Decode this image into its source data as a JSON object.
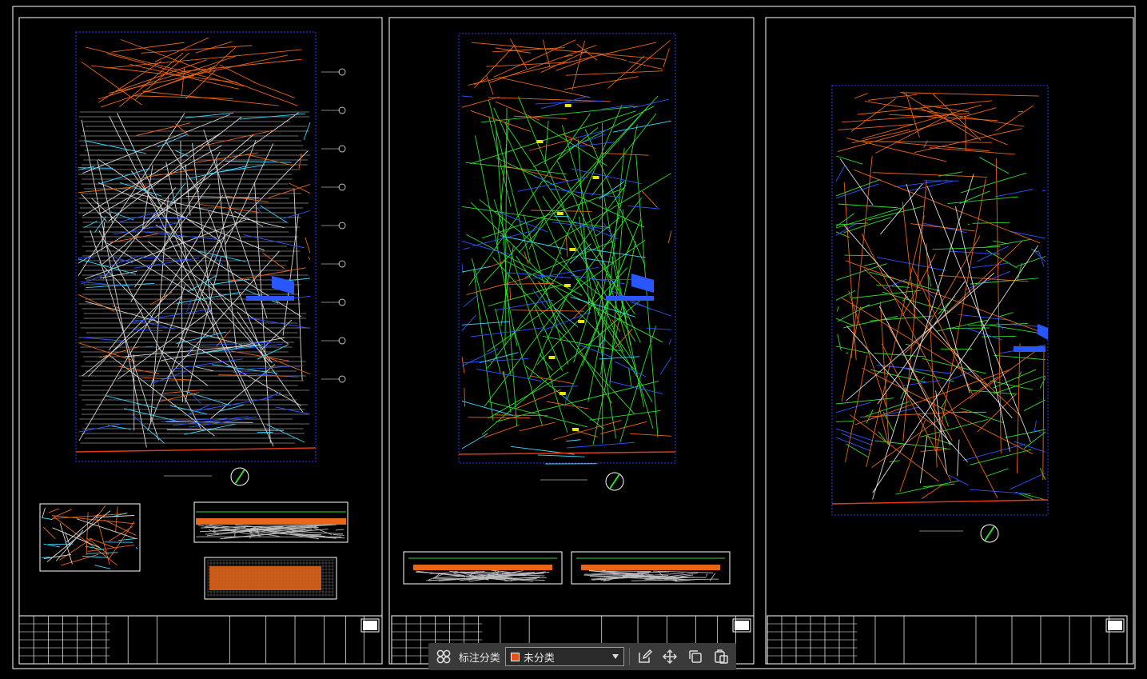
{
  "toolbar": {
    "category_label": "标注分类",
    "category_value": "未分类",
    "category_color": "#e8501a",
    "icons": [
      "group-icon",
      "annotate-edit-icon",
      "move-icon",
      "copy-icon",
      "paste-icon"
    ]
  },
  "colors": {
    "background": "#000000",
    "frame": "#ffffff",
    "viewport": "#2b3cff",
    "orange": "#e8661a",
    "white_line": "#d8d8d8",
    "cyan": "#3ad7ff",
    "blue": "#2a56ff",
    "green": "#2fdc2f",
    "yellow": "#e8e800",
    "red": "#e03a1a"
  }
}
